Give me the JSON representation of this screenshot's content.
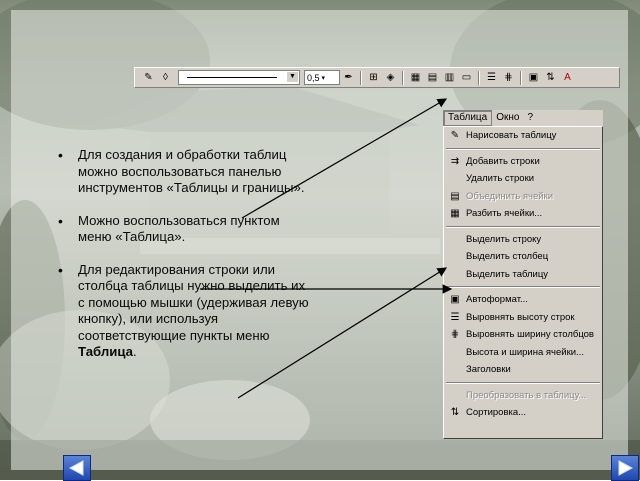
{
  "slide": {
    "bullets": [
      {
        "text": "Для создания и обработки таблиц можно воспользоваться панелью инструментов «Таблицы и границы»."
      },
      {
        "text": "Можно воспользоваться пунктом меню «Таблица»."
      },
      {
        "text_before": "Для редактирования строки или столбца таблицы нужно выделить их с помощью мышки (удерживая левую кнопку), или используя соответствующие пункты меню ",
        "bold": "Таблица",
        "text_after": "."
      }
    ]
  },
  "toolbar": {
    "line_width": "0,5",
    "icons": [
      "pencil-icon",
      "eraser-icon",
      "line-style-dropdown",
      "line-width-dropdown",
      "border-color-icon",
      "borders-icon",
      "fill-color-icon",
      "merge-cells-icon",
      "split-cells-icon",
      "align-icon",
      "distribute-rows-icon",
      "distribute-columns-icon",
      "autoformat-icon",
      "sort-icon"
    ]
  },
  "menubar": {
    "items": [
      "Таблица",
      "Окно",
      "?"
    ]
  },
  "menu": {
    "items": [
      {
        "label": "Нарисовать таблицу",
        "icon": "pencil-icon",
        "disabled": false
      },
      {
        "separator": true
      },
      {
        "label": "Добавить строки",
        "icon": "insert-rows-icon",
        "disabled": false
      },
      {
        "label": "Удалить строки",
        "icon": "",
        "disabled": false
      },
      {
        "label": "Объединить ячейки",
        "icon": "merge-cells-icon",
        "disabled": true
      },
      {
        "label": "Разбить ячейки...",
        "icon": "split-cells-icon",
        "disabled": false
      },
      {
        "separator": true
      },
      {
        "label": "Выделить строку",
        "icon": "",
        "disabled": false
      },
      {
        "label": "Выделить столбец",
        "icon": "",
        "disabled": false
      },
      {
        "label": "Выделить таблицу",
        "icon": "",
        "disabled": false
      },
      {
        "separator": true
      },
      {
        "label": "Автоформат...",
        "icon": "autoformat-icon",
        "disabled": false
      },
      {
        "label": "Выровнять высоту строк",
        "icon": "distribute-rows-icon",
        "disabled": false
      },
      {
        "label": "Выровнять ширину столбцов",
        "icon": "distribute-columns-icon",
        "disabled": false
      },
      {
        "label": "Высота и ширина ячейки...",
        "icon": "",
        "disabled": false
      },
      {
        "label": "Заголовки",
        "icon": "",
        "disabled": false
      },
      {
        "separator": true
      },
      {
        "label": "Преобразовать в таблицу...",
        "icon": "",
        "disabled": true
      },
      {
        "label": "Сортировка...",
        "icon": "sort-icon",
        "disabled": false
      }
    ]
  },
  "nav": {
    "prev": "prev-slide-arrow-icon",
    "next": "next-slide-arrow-icon"
  },
  "colors": {
    "menu_bg": "#d4d0c8",
    "nav_blue": "#1f47b0"
  }
}
